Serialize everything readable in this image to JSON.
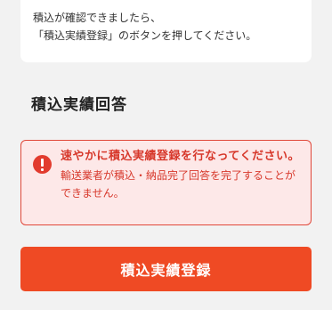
{
  "info_card": {
    "line1": "積込が確認できましたら、",
    "line2": "「積込実績登録」のボタンを押してください。"
  },
  "section_title": "積込実績回答",
  "alert": {
    "icon": "exclamation-circle-icon",
    "title": "速やかに積込実績登録を行なってください。",
    "body": "輸送業者が積込・納品完了回答を完了することができません。",
    "color": "#d7382b",
    "background": "#fde8e8"
  },
  "register_button": {
    "label": "積込実績登録",
    "color": "#ef4a24"
  }
}
